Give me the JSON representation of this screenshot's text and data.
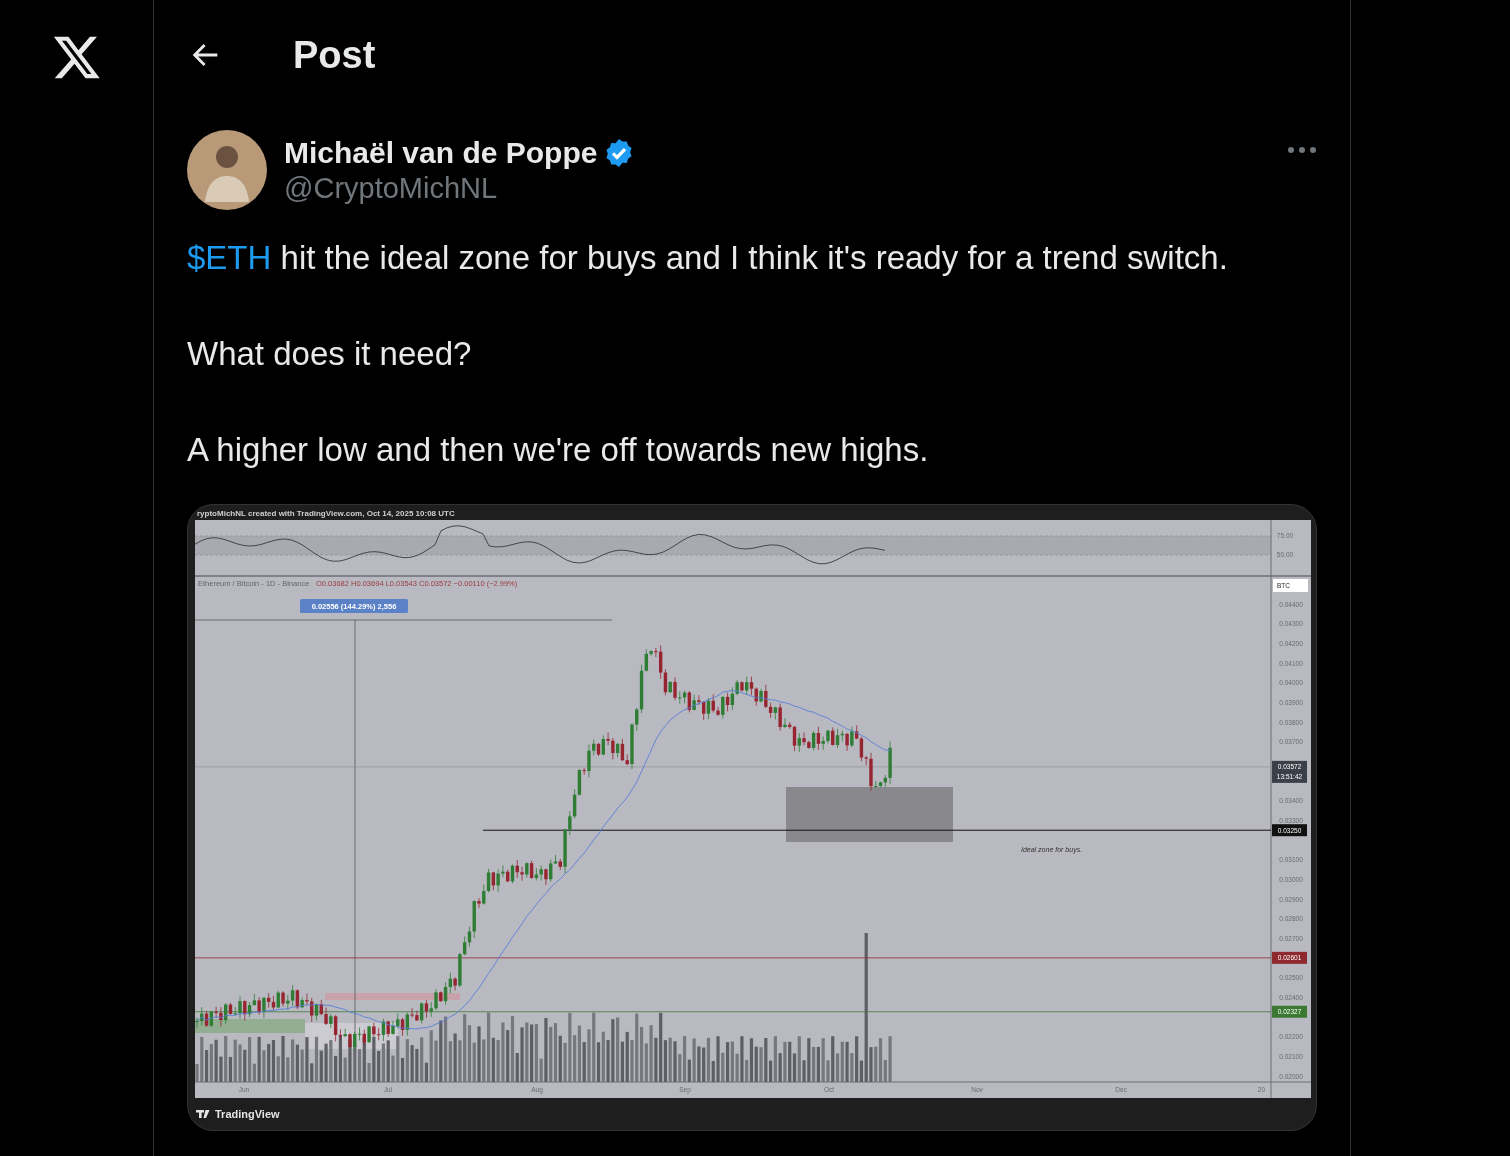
{
  "header": {
    "title": "Post"
  },
  "post": {
    "author": {
      "name": "Michaël van de Poppe",
      "handle": "@CryptoMichNL",
      "verified": true
    },
    "paragraphs": [
      {
        "parts": [
          {
            "kind": "cashtag",
            "text": "$ETH"
          },
          {
            "kind": "text",
            "text": " hit the ideal zone for buys and I think it's ready for a trend switch."
          }
        ]
      },
      {
        "parts": [
          {
            "kind": "text",
            "text": "What does it need?"
          }
        ]
      },
      {
        "parts": [
          {
            "kind": "text",
            "text": "A higher low and then we're off towards new highs."
          }
        ]
      }
    ],
    "chart": {
      "caption": "ryptoMichNL created with TradingView.com, Oct 14, 2025 10:08 UTC",
      "legend": "Ethereum / Bitcoin - 1D - Binance",
      "ohlc": "O0.03682  H0.03694  L0.03543  C0.03572  −0.00110 (−2.99%)",
      "measure_label": "0.02556 (144.29%) 2,556",
      "oscillator_ticks": [
        "75.00",
        "50.00"
      ],
      "currency": "BTC",
      "price_ticks": [
        "0.04400",
        "0.04300",
        "0.04200",
        "0.04100",
        "0.04000",
        "0.03900",
        "0.03800",
        "0.03700",
        "0.03400",
        "0.03300",
        "0.03100",
        "0.03000",
        "0.02900",
        "0.02800",
        "0.02700",
        "0.02500",
        "0.02400",
        "0.02200",
        "0.02100",
        "0.02000"
      ],
      "price_tags": [
        {
          "kind": "current",
          "lines": [
            "0.03572",
            "13:51:42"
          ],
          "color": "#3b3f48"
        },
        {
          "kind": "zone",
          "lines": [
            "0.03250"
          ],
          "color": "#111111"
        },
        {
          "kind": "level",
          "lines": [
            "0.02601"
          ],
          "color": "#8e2a2e"
        },
        {
          "kind": "level",
          "lines": [
            "0.02327"
          ],
          "color": "#3c7a34"
        }
      ],
      "x_labels": [
        "Jun",
        "Jul",
        "Aug",
        "Sep",
        "Oct",
        "Nov",
        "Dec",
        "20"
      ],
      "annotation": "Ideal zone for buys.",
      "brand": "TradingView"
    }
  }
}
